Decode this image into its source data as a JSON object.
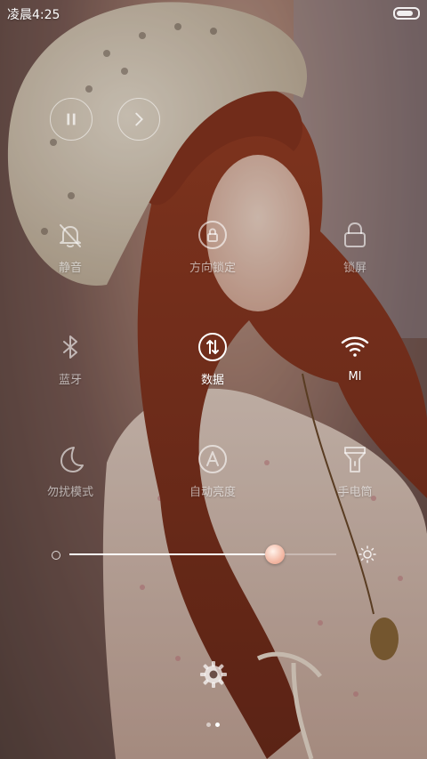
{
  "status_bar": {
    "time": "凌晨4:25"
  },
  "toggles": [
    {
      "id": "silent",
      "label": "静音",
      "icon": "bell-off-icon",
      "active": false
    },
    {
      "id": "rotation-lock",
      "label": "方向锁定",
      "icon": "rotation-lock-icon",
      "active": false
    },
    {
      "id": "lock-screen",
      "label": "锁屏",
      "icon": "lock-icon",
      "active": false
    },
    {
      "id": "bluetooth",
      "label": "蓝牙",
      "icon": "bluetooth-icon",
      "active": false
    },
    {
      "id": "data",
      "label": "数据",
      "icon": "data-arrows-icon",
      "active": true
    },
    {
      "id": "wifi",
      "label": "MI",
      "icon": "wifi-icon",
      "active": true
    },
    {
      "id": "dnd",
      "label": "勿扰模式",
      "icon": "moon-icon",
      "active": false
    },
    {
      "id": "auto-brightness",
      "label": "自动亮度",
      "icon": "auto-brightness-icon",
      "active": false
    },
    {
      "id": "flashlight",
      "label": "手电筒",
      "icon": "flashlight-icon",
      "active": false
    }
  ],
  "brightness": {
    "level": 0.77
  },
  "media": {
    "pause_icon": "pause-icon",
    "next_icon": "next-icon"
  },
  "settings": {
    "icon": "gear-icon"
  },
  "pager": {
    "current_page": 2,
    "page_count": 2
  },
  "colors": {
    "active": "#ffffff",
    "inactive": "rgba(255,255,255,0.6)",
    "slider_thumb": "#f3b9a5"
  }
}
